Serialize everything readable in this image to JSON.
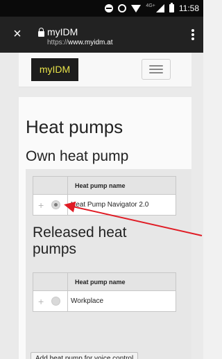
{
  "status_bar": {
    "network_label": "4G+",
    "time": "11:58",
    "icons": [
      "do-not-disturb-icon",
      "alarm-icon",
      "wifi-icon",
      "signal-icon",
      "battery-icon"
    ]
  },
  "browser": {
    "close_icon": "×",
    "site_title": "myIDM",
    "url_scheme": "https://",
    "url_host": "www.myidm.at"
  },
  "site": {
    "logo_text": "myIDM"
  },
  "main": {
    "page_title": "Heat pumps",
    "own_section_title": "Own heat pump",
    "released_section_title": "Released heat pumps",
    "own_table": {
      "column_header": "Heat pump name",
      "rows": [
        {
          "name": "Heat Pump Navigator 2.0",
          "selected": true
        }
      ]
    },
    "released_table": {
      "column_header": "Heat pump name",
      "rows": [
        {
          "name": "Workplace",
          "selected": false
        }
      ]
    },
    "add_button_label": "Add heat pump for voice control"
  },
  "colors": {
    "status_bar": "#0a0a0a",
    "browser_bar": "#222222",
    "logo_bg": "#1d1d1d",
    "logo_text": "#e8e34a",
    "annotation_arrow": "#e01b24"
  }
}
